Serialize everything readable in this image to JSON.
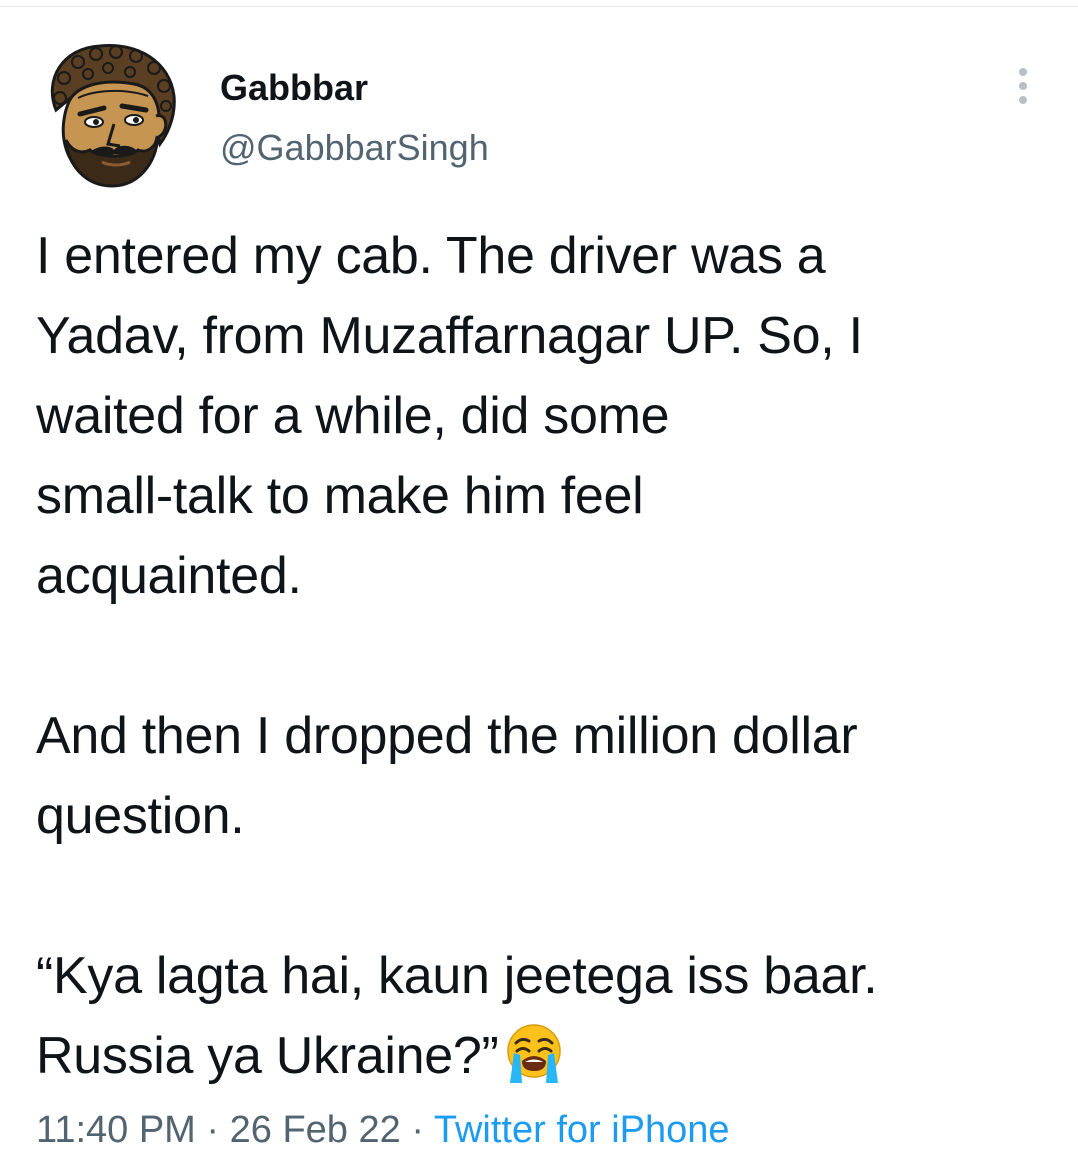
{
  "author": {
    "display_name": "Gabbbar",
    "handle": "@GabbbarSingh",
    "avatar_icon": "cartoon-face-avatar"
  },
  "menu": {
    "more_icon": "more-vertical-icon"
  },
  "tweet": {
    "text": "I entered my cab. The driver was a\nYadav, from Muzaffarnagar UP. So, I\nwaited for a while, did some\nsmall-talk to make him feel\nacquainted.\n\nAnd then I dropped the million dollar\nquestion.\n\n“Kya lagta hai, kaun jeetega iss baar.\nRussia ya Ukraine?”",
    "emoji_icon": "loudly-crying-face-icon"
  },
  "meta": {
    "time": "11:40 PM",
    "separator": " · ",
    "date": "26 Feb 22",
    "source": "Twitter for iPhone"
  },
  "colors": {
    "text": "#0f1419",
    "secondary": "#536471",
    "link": "#1d9bf0"
  }
}
